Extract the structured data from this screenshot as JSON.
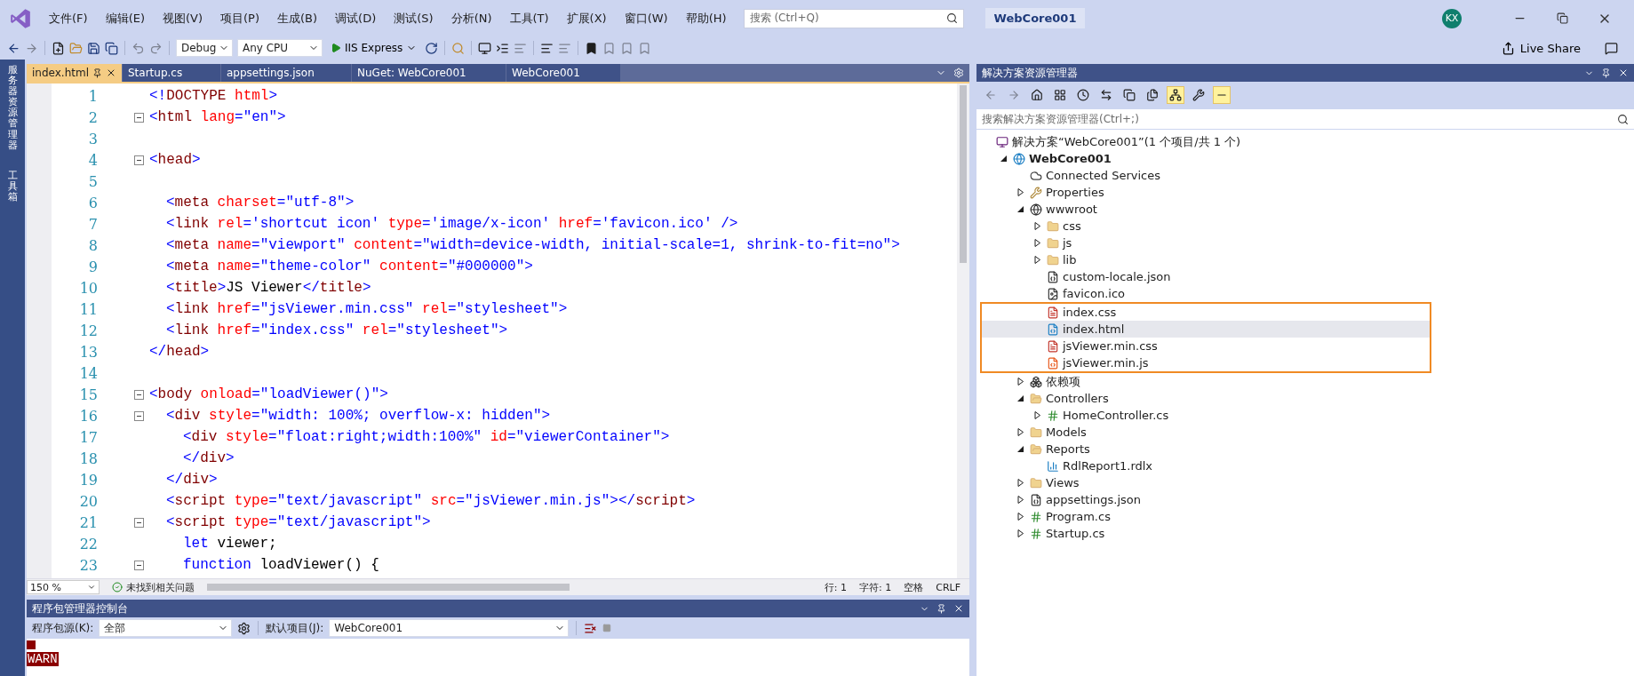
{
  "menu_bar": {
    "items": [
      "文件(F)",
      "编辑(E)",
      "视图(V)",
      "项目(P)",
      "生成(B)",
      "调试(D)",
      "测试(S)",
      "分析(N)",
      "工具(T)",
      "扩展(X)",
      "窗口(W)",
      "帮助(H)"
    ],
    "search": {
      "placeholder": "搜索 (Ctrl+Q)"
    },
    "solution_name": "WebCore001",
    "avatar": "KX"
  },
  "toolbar": {
    "configuration": "Debug",
    "platform": "Any CPU",
    "run_target": "IIS Express",
    "live_share": "Live Share"
  },
  "side_tabs": [
    "服务器资源管理器",
    "工具箱"
  ],
  "editor": {
    "tabs": [
      {
        "label": "index.html",
        "selected": true
      },
      {
        "label": "Startup.cs",
        "selected": false
      },
      {
        "label": "appsettings.json",
        "selected": false
      },
      {
        "label": "NuGet: WebCore001",
        "selected": false
      },
      {
        "label": "WebCore001",
        "selected": false
      }
    ],
    "lines": [
      {
        "number": "1",
        "fold": false,
        "kind": "root",
        "tokens": [
          {
            "kind": "delim",
            "text": "<!"
          },
          {
            "kind": "element",
            "text": "DOCTYPE"
          },
          {
            "kind": "attr",
            "text": " html"
          },
          {
            "kind": "delim",
            "text": ">"
          }
        ]
      },
      {
        "number": "2",
        "fold": true,
        "kind": "root",
        "tokens": [
          {
            "kind": "delim",
            "text": "<"
          },
          {
            "kind": "element",
            "text": "html"
          },
          {
            "kind": "attr",
            "text": " lang"
          },
          {
            "kind": "delim",
            "text": "="
          },
          {
            "kind": "value",
            "text": "\"en\""
          },
          {
            "kind": "delim",
            "text": ">"
          }
        ]
      },
      {
        "number": "3",
        "fold": false
      },
      {
        "number": "4",
        "fold": true,
        "kind": "root",
        "tokens": [
          {
            "kind": "delim",
            "text": "<"
          },
          {
            "kind": "element",
            "text": "head"
          },
          {
            "kind": "delim",
            "text": ">"
          }
        ]
      },
      {
        "number": "5",
        "fold": false
      },
      {
        "number": "6",
        "fold": false,
        "kind": "child",
        "tokens": [
          {
            "kind": "delim",
            "text": "<"
          },
          {
            "kind": "element",
            "text": "meta"
          },
          {
            "kind": "attr",
            "text": " charset"
          },
          {
            "kind": "delim",
            "text": "="
          },
          {
            "kind": "value",
            "text": "\"utf-8\""
          },
          {
            "kind": "delim",
            "text": ">"
          }
        ]
      },
      {
        "number": "7",
        "fold": false,
        "kind": "child",
        "tokens": [
          {
            "kind": "delim",
            "text": "<"
          },
          {
            "kind": "element",
            "text": "link"
          },
          {
            "kind": "attr",
            "text": " rel"
          },
          {
            "kind": "delim",
            "text": "="
          },
          {
            "kind": "value",
            "text": "'shortcut icon'"
          },
          {
            "kind": "attr",
            "text": " type"
          },
          {
            "kind": "delim",
            "text": "="
          },
          {
            "kind": "value",
            "text": "'image/x-icon'"
          },
          {
            "kind": "attr",
            "text": " href"
          },
          {
            "kind": "delim",
            "text": "="
          },
          {
            "kind": "value",
            "text": "'favicon.ico'"
          },
          {
            "kind": "delim",
            "text": " />"
          }
        ]
      },
      {
        "number": "8",
        "fold": false,
        "kind": "child",
        "tokens": [
          {
            "kind": "delim",
            "text": "<"
          },
          {
            "kind": "element",
            "text": "meta"
          },
          {
            "kind": "attr",
            "text": " name"
          },
          {
            "kind": "delim",
            "text": "="
          },
          {
            "kind": "value",
            "text": "\"viewport\""
          },
          {
            "kind": "attr",
            "text": " content"
          },
          {
            "kind": "delim",
            "text": "="
          },
          {
            "kind": "value",
            "text": "\"width=device-width, initial-scale=1, shrink-to-fit=no\""
          },
          {
            "kind": "delim",
            "text": ">"
          }
        ]
      },
      {
        "number": "9",
        "fold": false,
        "kind": "child",
        "tokens": [
          {
            "kind": "delim",
            "text": "<"
          },
          {
            "kind": "element",
            "text": "meta"
          },
          {
            "kind": "attr",
            "text": " name"
          },
          {
            "kind": "delim",
            "text": "="
          },
          {
            "kind": "value",
            "text": "\"theme-color\""
          },
          {
            "kind": "attr",
            "text": " content"
          },
          {
            "kind": "delim",
            "text": "="
          },
          {
            "kind": "value",
            "text": "\"#000000\""
          },
          {
            "kind": "delim",
            "text": ">"
          }
        ]
      },
      {
        "number": "10",
        "fold": false,
        "kind": "child",
        "tokens": [
          {
            "kind": "delim",
            "text": "<"
          },
          {
            "kind": "element",
            "text": "title"
          },
          {
            "kind": "delim",
            "text": ">"
          },
          {
            "kind": "plain",
            "text": "JS Viewer"
          },
          {
            "kind": "delim",
            "text": "</"
          },
          {
            "kind": "element",
            "text": "title"
          },
          {
            "kind": "delim",
            "text": ">"
          }
        ]
      },
      {
        "number": "11",
        "fold": false,
        "kind": "child",
        "tokens": [
          {
            "kind": "delim",
            "text": "<"
          },
          {
            "kind": "element",
            "text": "link"
          },
          {
            "kind": "attr",
            "text": " href"
          },
          {
            "kind": "delim",
            "text": "="
          },
          {
            "kind": "value",
            "text": "\"jsViewer.min.css\""
          },
          {
            "kind": "attr",
            "text": " rel"
          },
          {
            "kind": "delim",
            "text": "="
          },
          {
            "kind": "value",
            "text": "\"stylesheet\""
          },
          {
            "kind": "delim",
            "text": ">"
          }
        ]
      },
      {
        "number": "12",
        "fold": false,
        "kind": "child",
        "tokens": [
          {
            "kind": "delim",
            "text": "<"
          },
          {
            "kind": "element",
            "text": "link"
          },
          {
            "kind": "attr",
            "text": " href"
          },
          {
            "kind": "delim",
            "text": "="
          },
          {
            "kind": "value",
            "text": "\"index.css\""
          },
          {
            "kind": "attr",
            "text": " rel"
          },
          {
            "kind": "delim",
            "text": "="
          },
          {
            "kind": "value",
            "text": "\"stylesheet\""
          },
          {
            "kind": "delim",
            "text": ">"
          }
        ]
      },
      {
        "number": "13",
        "fold": false,
        "kind": "root",
        "tokens": [
          {
            "kind": "delim",
            "text": "</"
          },
          {
            "kind": "element",
            "text": "head"
          },
          {
            "kind": "delim",
            "text": ">"
          }
        ]
      },
      {
        "number": "14",
        "fold": false
      },
      {
        "number": "15",
        "fold": true,
        "kind": "root",
        "tokens": [
          {
            "kind": "delim",
            "text": "<"
          },
          {
            "kind": "element",
            "text": "body"
          },
          {
            "kind": "attr",
            "text": " onload"
          },
          {
            "kind": "delim",
            "text": "="
          },
          {
            "kind": "value",
            "text": "\"loadViewer()\""
          },
          {
            "kind": "delim",
            "text": ">"
          }
        ]
      },
      {
        "number": "16",
        "fold": true,
        "kind": "child",
        "tokens": [
          {
            "kind": "delim",
            "text": "<"
          },
          {
            "kind": "element",
            "text": "div"
          },
          {
            "kind": "attr",
            "text": " style"
          },
          {
            "kind": "delim",
            "text": "="
          },
          {
            "kind": "value",
            "text": "\"width: 100%; overflow-x: hidden\""
          },
          {
            "kind": "delim",
            "text": ">"
          }
        ]
      },
      {
        "number": "17",
        "fold": false,
        "kind": "grandchild",
        "tokens": [
          {
            "kind": "delim",
            "text": "<"
          },
          {
            "kind": "element",
            "text": "div"
          },
          {
            "kind": "attr",
            "text": " style"
          },
          {
            "kind": "delim",
            "text": "="
          },
          {
            "kind": "value",
            "text": "\"float:right;width:100%\""
          },
          {
            "kind": "attr",
            "text": " id"
          },
          {
            "kind": "delim",
            "text": "="
          },
          {
            "kind": "value",
            "text": "\"viewerContainer\""
          },
          {
            "kind": "delim",
            "text": ">"
          }
        ]
      },
      {
        "number": "18",
        "fold": false,
        "kind": "grandchild",
        "tokens": [
          {
            "kind": "delim",
            "text": "</"
          },
          {
            "kind": "element",
            "text": "div"
          },
          {
            "kind": "delim",
            "text": ">"
          }
        ]
      },
      {
        "number": "19",
        "fold": false,
        "kind": "child",
        "tokens": [
          {
            "kind": "delim",
            "text": "</"
          },
          {
            "kind": "element",
            "text": "div"
          },
          {
            "kind": "delim",
            "text": ">"
          }
        ]
      },
      {
        "number": "20",
        "fold": false,
        "kind": "child",
        "tokens": [
          {
            "kind": "delim",
            "text": "<"
          },
          {
            "kind": "element",
            "text": "script"
          },
          {
            "kind": "attr",
            "text": " type"
          },
          {
            "kind": "delim",
            "text": "="
          },
          {
            "kind": "value",
            "text": "\"text/javascript\""
          },
          {
            "kind": "attr",
            "text": " src"
          },
          {
            "kind": "delim",
            "text": "="
          },
          {
            "kind": "value",
            "text": "\"jsViewer.min.js\""
          },
          {
            "kind": "delim",
            "text": "></"
          },
          {
            "kind": "element",
            "text": "script"
          },
          {
            "kind": "delim",
            "text": ">"
          }
        ]
      },
      {
        "number": "21",
        "fold": true,
        "kind": "child",
        "tokens": [
          {
            "kind": "delim",
            "text": "<"
          },
          {
            "kind": "element",
            "text": "script"
          },
          {
            "kind": "attr",
            "text": " type"
          },
          {
            "kind": "delim",
            "text": "="
          },
          {
            "kind": "value",
            "text": "\"text/javascript\""
          },
          {
            "kind": "delim",
            "text": ">"
          }
        ]
      },
      {
        "number": "22",
        "fold": false,
        "kind": "grandchild",
        "tokens": [
          {
            "kind": "keyword",
            "text": "let"
          },
          {
            "kind": "plain",
            "text": " viewer;"
          }
        ]
      },
      {
        "number": "23",
        "fold": true,
        "kind": "grandchild",
        "tokens": [
          {
            "kind": "keyword",
            "text": "function"
          },
          {
            "kind": "plain",
            "text": " loadViewer() {"
          }
        ]
      }
    ],
    "status": {
      "zoom": "150 %",
      "issues": "未找到相关问题",
      "line": "行: 1",
      "char": "字符: 1",
      "whitespace": "空格",
      "line_ending": "CRLF"
    }
  },
  "solution_explorer": {
    "title": "解决方案资源管理器",
    "buttons": [
      {
        "kind": "back",
        "on": false
      },
      {
        "kind": "forward",
        "on": false
      },
      {
        "kind": "home",
        "on": false
      },
      {
        "kind": "views",
        "on": false
      },
      {
        "kind": "history",
        "on": false
      },
      {
        "kind": "sync",
        "on": false
      },
      {
        "kind": "collapse",
        "on": false
      },
      {
        "kind": "show-all",
        "on": false
      },
      {
        "kind": "tree",
        "on": true
      },
      {
        "kind": "properties",
        "on": false
      },
      {
        "kind": "preview",
        "on": true
      }
    ],
    "search": {
      "placeholder": "搜索解决方案资源管理器(Ctrl+;)"
    },
    "tree": [
      {
        "label": "解决方案“WebCore001”(1 个项目/共 1 个)",
        "kind": "solution",
        "selected": false,
        "children": [
          {
            "label": "WebCore001",
            "kind": "project",
            "expanded": true,
            "selected": false,
            "children": [
              {
                "label": "Connected Services",
                "kind": "cloud",
                "selected": false
              },
              {
                "label": "Properties",
                "kind": "properties",
                "expanded": false,
                "selected": false
              },
              {
                "label": "wwwroot",
                "kind": "globe",
                "expanded": true,
                "selected": false,
                "children": [
                  {
                    "label": "css",
                    "kind": "folder",
                    "expanded": false,
                    "selected": false,
                    "outlined": false
                  },
                  {
                    "label": "js",
                    "kind": "folder",
                    "expanded": false,
                    "selected": false,
                    "outlined": false
                  },
                  {
                    "label": "lib",
                    "kind": "folder",
                    "expanded": false,
                    "selected": false,
                    "outlined": false
                  },
                  {
                    "label": "custom-locale.json",
                    "kind": "json",
                    "selected": false,
                    "outlined": false
                  },
                  {
                    "label": "favicon.ico",
                    "kind": "image",
                    "selected": false,
                    "outlined": false
                  },
                  {
                    "label": "index.css",
                    "kind": "stylesheet",
                    "selected": false,
                    "outlined": true
                  },
                  {
                    "label": "index.html",
                    "kind": "html",
                    "selected": true,
                    "outlined": true
                  },
                  {
                    "label": "jsViewer.min.css",
                    "kind": "stylesheet",
                    "selected": false,
                    "outlined": true
                  },
                  {
                    "label": "jsViewer.min.js",
                    "kind": "script",
                    "selected": false,
                    "outlined": true
                  }
                ]
              },
              {
                "label": "依赖项",
                "kind": "deps",
                "expanded": false,
                "selected": false
              },
              {
                "label": "Controllers",
                "kind": "folder",
                "expanded": true,
                "selected": false,
                "children": [
                  {
                    "label": "HomeController.cs",
                    "kind": "csharp",
                    "expanded": false,
                    "selected": false
                  }
                ]
              },
              {
                "label": "Models",
                "kind": "folder",
                "expanded": false,
                "selected": false
              },
              {
                "label": "Reports",
                "kind": "folder",
                "expanded": true,
                "selected": false,
                "children": [
                  {
                    "label": "RdlReport1.rdlx",
                    "kind": "report",
                    "selected": false
                  }
                ]
              },
              {
                "label": "Views",
                "kind": "folder",
                "expanded": false,
                "selected": false
              },
              {
                "label": "appsettings.json",
                "kind": "json",
                "expanded": false,
                "selected": false
              },
              {
                "label": "Program.cs",
                "kind": "csharp",
                "expanded": false,
                "selected": false
              },
              {
                "label": "Startup.cs",
                "kind": "csharp",
                "expanded": false,
                "selected": false
              }
            ]
          }
        ]
      }
    ]
  },
  "package_console": {
    "title": "程序包管理器控制台",
    "source_label": "程序包源(K):",
    "source": "全部",
    "project_label": "默认项目(J):",
    "project": "WebCore001",
    "output": [
      "WARN"
    ]
  }
}
